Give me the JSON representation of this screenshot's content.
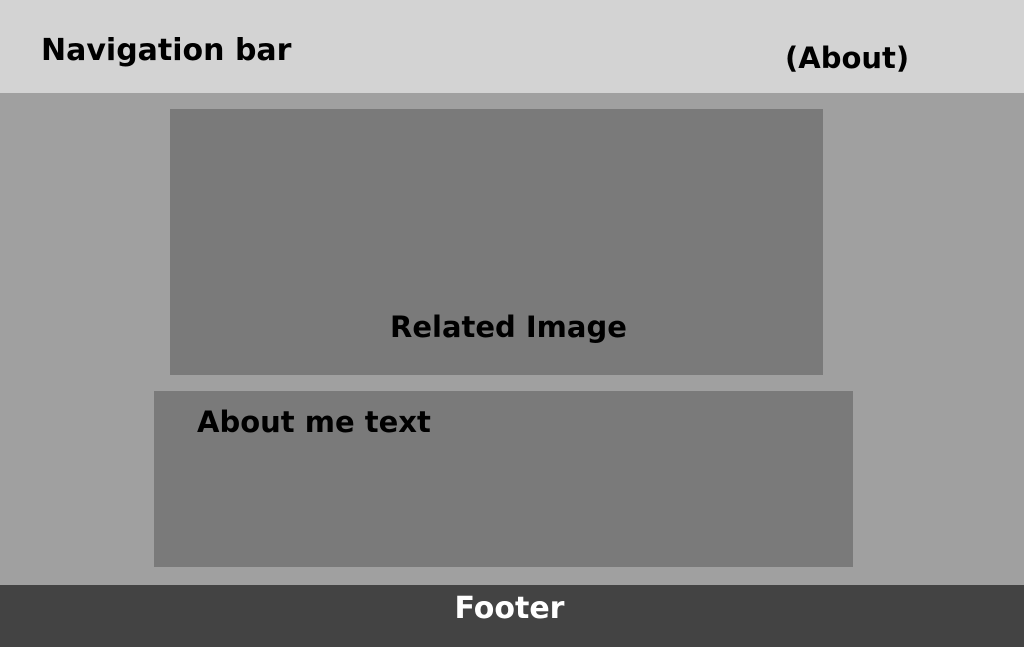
{
  "navbar": {
    "title": "Navigation bar",
    "link": "(About)"
  },
  "main": {
    "image_label": "Related Image",
    "about_label": "About me text"
  },
  "footer": {
    "label": "Footer"
  },
  "colors": {
    "page_background": "#a0a0a0",
    "navbar_background": "#d3d3d3",
    "content_box": "#7a7a7a",
    "footer_background": "#434343",
    "footer_text": "#ffffff"
  }
}
